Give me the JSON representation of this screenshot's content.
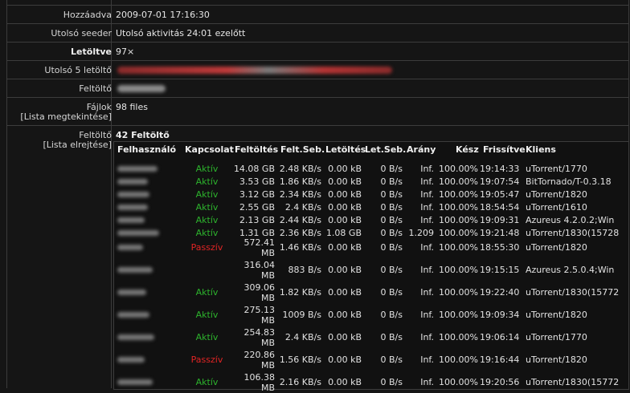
{
  "details": {
    "hozzaadva": {
      "label": "Hozzáadva",
      "value": "2009-07-01 17:16:30"
    },
    "utolso_seeder": {
      "label": "Utolsó seeder",
      "value": "Utolsó aktivitás 24:01 ezelőtt"
    },
    "letoltve": {
      "label": "Letöltve",
      "value": "97×"
    },
    "utolso_5": {
      "label": "Utolsó 5 letöltő"
    },
    "feltolto": {
      "label": "Feltöltő"
    },
    "fajlok": {
      "label": "Fájlok",
      "link": "[Lista megtekintése]",
      "value": "98 files"
    },
    "feltoltok": {
      "label": "Feltöltő",
      "link": "[Lista elrejtése]",
      "title": "42 Feltöltő"
    }
  },
  "table": {
    "headers": [
      "Felhasználó",
      "Kapcsolat",
      "Feltöltés",
      "Felt.Seb.",
      "Letöltés",
      "Let.Seb.",
      "Arány",
      "Kész",
      "Frissítve",
      "Kliens"
    ],
    "rows": [
      {
        "conn": "Aktív",
        "up": "14.08 GB",
        "upspd": "2.48 KB/s",
        "down": "0.00 kB",
        "downspd": "0 B/s",
        "ratio": "Inf.",
        "done": "100.00%",
        "upd": "19:14:33",
        "client": "uTorrent/1770"
      },
      {
        "conn": "Aktív",
        "up": "3.53 GB",
        "upspd": "1.86 KB/s",
        "down": "0.00 kB",
        "downspd": "0 B/s",
        "ratio": "Inf.",
        "done": "100.00%",
        "upd": "19:07:54",
        "client": "BitTornado/T-0.3.18"
      },
      {
        "conn": "Aktív",
        "up": "3.12 GB",
        "upspd": "2.34 KB/s",
        "down": "0.00 kB",
        "downspd": "0 B/s",
        "ratio": "Inf.",
        "done": "100.00%",
        "upd": "19:05:47",
        "client": "uTorrent/1820"
      },
      {
        "conn": "Aktív",
        "up": "2.55 GB",
        "upspd": "2.4 KB/s",
        "down": "0.00 kB",
        "downspd": "0 B/s",
        "ratio": "Inf.",
        "done": "100.00%",
        "upd": "18:54:54",
        "client": "uTorrent/1610"
      },
      {
        "conn": "Aktív",
        "up": "2.13 GB",
        "upspd": "2.44 KB/s",
        "down": "0.00 kB",
        "downspd": "0 B/s",
        "ratio": "Inf.",
        "done": "100.00%",
        "upd": "19:09:31",
        "client": "Azureus 4.2.0.2;Win"
      },
      {
        "conn": "Aktív",
        "up": "1.31 GB",
        "upspd": "2.36 KB/s",
        "down": "1.08 GB",
        "downspd": "0 B/s",
        "ratio": "1.209",
        "done": "100.00%",
        "upd": "19:21:48",
        "client": "uTorrent/1830(15728"
      },
      {
        "conn": "Passzív",
        "up1": "572.41",
        "up2": "MB",
        "upspd": "1.46 KB/s",
        "down": "0.00 kB",
        "downspd": "0 B/s",
        "ratio": "Inf.",
        "done": "100.00%",
        "upd": "18:55:30",
        "client": "uTorrent/1820"
      },
      {
        "conn": "",
        "up1": "316.04",
        "up2": "MB",
        "upspd": "883 B/s",
        "down": "0.00 kB",
        "downspd": "0 B/s",
        "ratio": "Inf.",
        "done": "100.00%",
        "upd": "19:15:15",
        "client": "Azureus 2.5.0.4;Win"
      },
      {
        "conn": "Aktív",
        "up1": "309.06",
        "up2": "MB",
        "upspd": "1.82 KB/s",
        "down": "0.00 kB",
        "downspd": "0 B/s",
        "ratio": "Inf.",
        "done": "100.00%",
        "upd": "19:22:40",
        "client": "uTorrent/1830(15772"
      },
      {
        "conn": "Aktív",
        "up1": "275.13",
        "up2": "MB",
        "upspd": "1009 B/s",
        "down": "0.00 kB",
        "downspd": "0 B/s",
        "ratio": "Inf.",
        "done": "100.00%",
        "upd": "19:09:34",
        "client": "uTorrent/1820"
      },
      {
        "conn": "Aktív",
        "up1": "254.83",
        "up2": "MB",
        "upspd": "2.4 KB/s",
        "down": "0.00 kB",
        "downspd": "0 B/s",
        "ratio": "Inf.",
        "done": "100.00%",
        "upd": "19:06:14",
        "client": "uTorrent/1770"
      },
      {
        "conn": "Passzív",
        "up1": "220.86",
        "up2": "MB",
        "upspd": "1.56 KB/s",
        "down": "0.00 kB",
        "downspd": "0 B/s",
        "ratio": "Inf.",
        "done": "100.00%",
        "upd": "19:16:44",
        "client": "uTorrent/1820"
      },
      {
        "conn": "Aktív",
        "up1": "106.38",
        "up2": "MB",
        "upspd": "2.16 KB/s",
        "down": "0.00 kB",
        "downspd": "0 B/s",
        "ratio": "Inf.",
        "done": "100.00%",
        "upd": "19:20:56",
        "client": "uTorrent/1830(15772"
      }
    ]
  },
  "colors": {
    "aktiv": "#2db32d",
    "passziv": "#e02424"
  }
}
